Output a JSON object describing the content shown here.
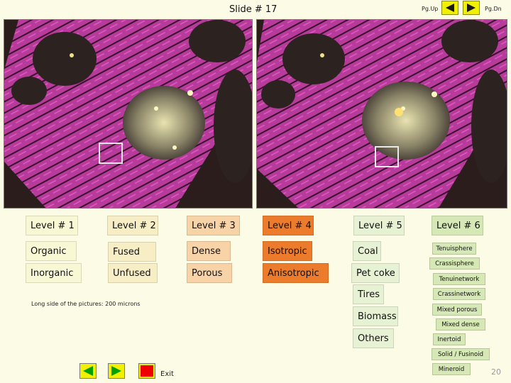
{
  "header": {
    "slide_title": "Slide # 17",
    "pg_up_label": "Pg.Up",
    "pg_dn_label": "Pg.Dn",
    "prev_icon": "triangle-left-icon",
    "next_icon": "triangle-right-icon"
  },
  "levels": {
    "level1": {
      "title": "Level # 1",
      "items": [
        "Organic",
        "Inorganic"
      ]
    },
    "level2": {
      "title": "Level # 2",
      "items": [
        "Fused",
        "Unfused"
      ]
    },
    "level3": {
      "title": "Level # 3",
      "items": [
        "Dense",
        "Porous"
      ]
    },
    "level4": {
      "title": "Level # 4",
      "items": [
        "Isotropic",
        "Anisotropic"
      ]
    },
    "level5": {
      "title": "Level # 5",
      "items": [
        "Coal",
        "Pet coke",
        "Tires",
        "Biomass",
        "Others"
      ]
    },
    "level6": {
      "title": "Level # 6",
      "items": [
        "Tenuisphere",
        "Crassisphere",
        "Tenuinetwork",
        "Crassinetwork",
        "Mixed porous",
        "Mixed dense",
        "Inertoid",
        "Solid / Fusinoid",
        "Mineroid"
      ]
    }
  },
  "note": "Long side of the pictures: 200 microns",
  "footer": {
    "exit_label": "Exit",
    "page_number": "20",
    "icons": [
      "triangle-left-icon",
      "triangle-right-icon",
      "stop-square-icon"
    ]
  },
  "colors": {
    "background": "#fbfbe6",
    "nav_yellow": "#f0f000",
    "level1": "#f8f8d4",
    "level2": "#f8eec6",
    "level3": "#f7d3a7",
    "level4": "#ec7c2c",
    "level5": "#e7f2d4",
    "level6": "#d6e8b6",
    "footer_green": "#00a000",
    "footer_red": "#ee0000"
  }
}
